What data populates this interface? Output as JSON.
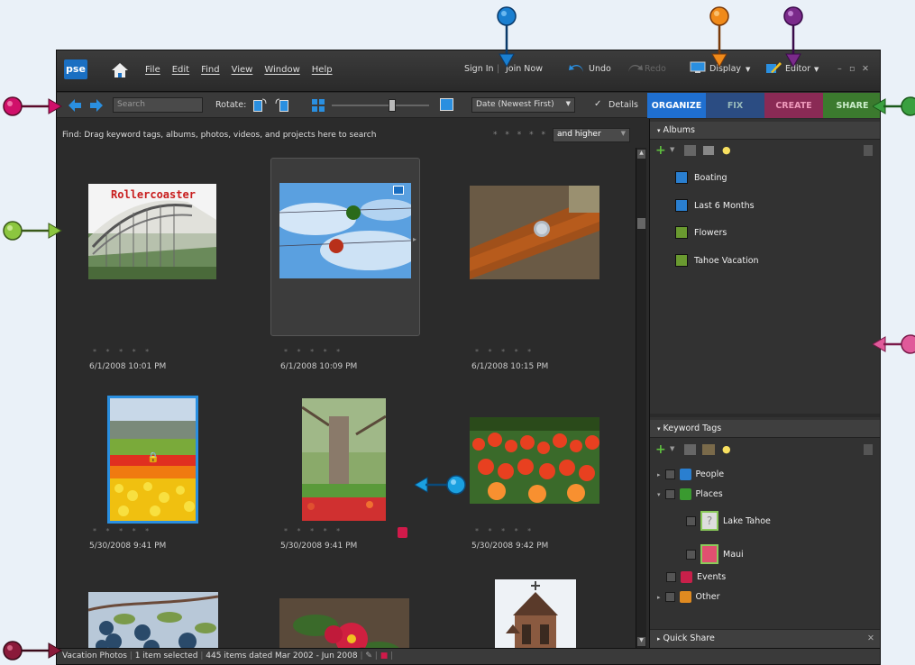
{
  "app": {
    "logo": "pse",
    "menu": [
      "File",
      "Edit",
      "Find",
      "View",
      "Window",
      "Help"
    ],
    "sign_in": "Sign In",
    "join_now": "Join Now",
    "undo": "Undo",
    "redo": "Redo",
    "display": "Display",
    "editor": "Editor"
  },
  "toolbar": {
    "search_placeholder": "Search",
    "rotate_label": "Rotate:",
    "sort": "Date (Newest First)",
    "details": "Details"
  },
  "tabs": [
    {
      "label": "ORGANIZE",
      "color": "#1f6fd0"
    },
    {
      "label": "FIX",
      "color": "#2b4c82"
    },
    {
      "label": "CREATE",
      "color": "#8a2a55"
    },
    {
      "label": "SHARE",
      "color": "#3b7a2e"
    }
  ],
  "find": {
    "text": "Find: Drag keyword tags, albums, photos, videos, and projects here to search",
    "stars": "* * * * *",
    "rating_filter": "and higher"
  },
  "photos": [
    {
      "caption": "Rollercoaster",
      "stars": "* * * * *",
      "date": "6/1/2008 10:01 PM"
    },
    {
      "caption": "",
      "stars": "* * * * *",
      "date": "6/1/2008 10:09 PM"
    },
    {
      "caption": "",
      "stars": "* * * * *",
      "date": "6/1/2008 10:15 PM"
    },
    {
      "caption": "",
      "stars": "* * * * *",
      "date": "5/30/2008 9:41 PM"
    },
    {
      "caption": "",
      "stars": "* * * * *",
      "date": "5/30/2008 9:41 PM"
    },
    {
      "caption": "",
      "stars": "* * * * *",
      "date": "5/30/2008 9:42 PM"
    }
  ],
  "albums": {
    "header": "Albums",
    "items": [
      {
        "label": "Boating",
        "color": "#2a7fd0"
      },
      {
        "label": "Last 6 Months",
        "color": "#2a7fd0"
      },
      {
        "label": "Flowers",
        "color": "#6a9a30"
      },
      {
        "label": "Tahoe Vacation",
        "color": "#6a9a30"
      }
    ]
  },
  "keywords": {
    "header": "Keyword Tags",
    "items": [
      {
        "label": "People",
        "color": "#2a7fd0"
      },
      {
        "label": "Places",
        "color": "#3a9a30"
      },
      {
        "label": "Lake Tahoe"
      },
      {
        "label": "Maui"
      },
      {
        "label": "Events",
        "color": "#c8204a"
      },
      {
        "label": "Other",
        "color": "#e08a20"
      }
    ]
  },
  "quick_share": "Quick Share",
  "status": {
    "album": "Vacation Photos",
    "selected": "1 item selected",
    "range": "445 items dated Mar 2002 - Jun 2008"
  },
  "pins": {
    "magenta": "#d0106a",
    "blue": "#1a7fd0",
    "orange": "#f08a1a",
    "purple": "#7a2a8a",
    "green": "#3aa040",
    "lime": "#8cc63f",
    "pink": "#e05a9a",
    "cyan": "#1aa0e0",
    "maroon": "#8a1a3a"
  }
}
